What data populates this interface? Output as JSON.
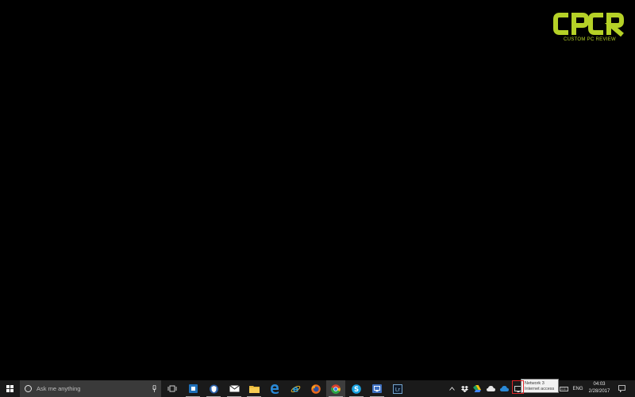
{
  "watermark": {
    "logo_text": "CPCR",
    "tagline": "CUSTOM PC REVIEW",
    "color": "#b5d127"
  },
  "taskbar": {
    "start_icon": "windows-logo-icon",
    "search": {
      "placeholder": "Ask me anything",
      "left_icon": "cortana-ring-icon",
      "right_icon": "microphone-icon"
    },
    "apps": [
      {
        "name": "task-view-icon"
      },
      {
        "name": "blue-square-app-icon"
      },
      {
        "name": "shield-app-icon"
      },
      {
        "name": "mail-icon"
      },
      {
        "name": "file-explorer-icon"
      },
      {
        "name": "edge-icon"
      },
      {
        "name": "internet-explorer-icon"
      },
      {
        "name": "firefox-icon"
      },
      {
        "name": "chrome-icon"
      },
      {
        "name": "skype-icon"
      },
      {
        "name": "remote-app-icon"
      },
      {
        "name": "lightroom-icon",
        "label": "Lr"
      }
    ],
    "tray": {
      "chevron_icon": "chevron-up-icon",
      "icons": [
        "dropbox-icon",
        "google-drive-icon",
        "cloud-icon",
        "onedrive-icon",
        "network-icon",
        "keyboard-icon"
      ],
      "language": "ENG",
      "time": "04:03",
      "date": "2/28/2017",
      "notification_icon": "action-center-icon"
    }
  },
  "tooltip": {
    "line1": "Network  3",
    "line2": "Internet access"
  },
  "colors": {
    "taskbar_bg": "#1a1a1a",
    "search_bg": "#3a3a3a",
    "highlight": "#e0262a"
  }
}
